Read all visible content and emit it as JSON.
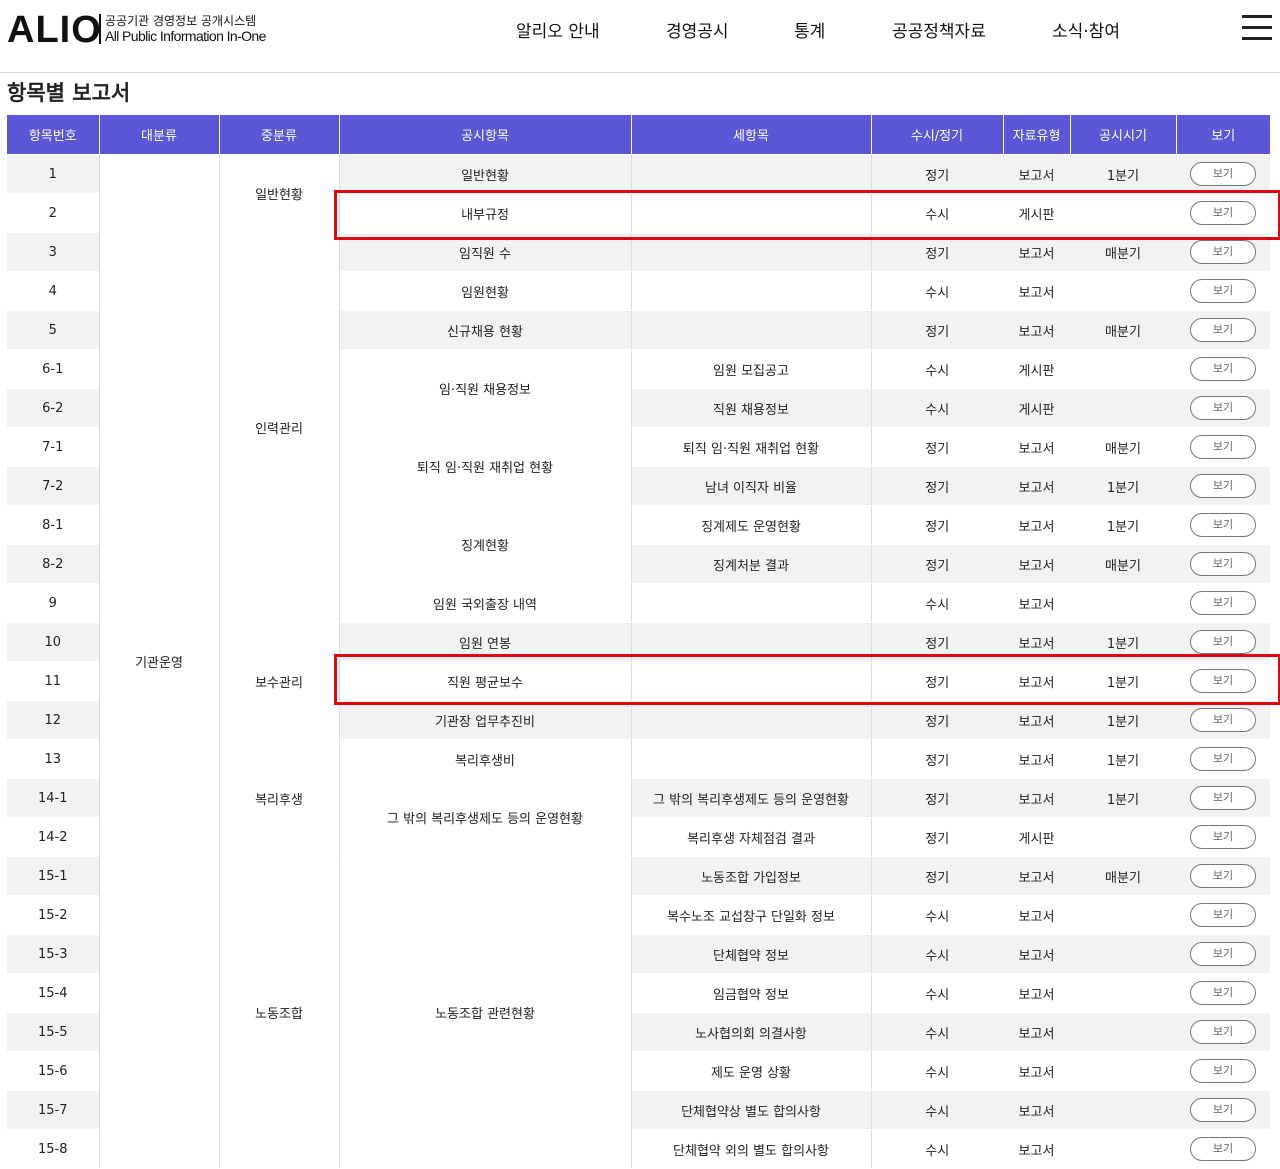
{
  "header": {
    "logo": "ALIO",
    "logo_ko": "공공기관 경영정보 공개시스템",
    "logo_en": "All Public Information In-One",
    "nav": [
      "알리오 안내",
      "경영공시",
      "통계",
      "공공정책자료",
      "소식·참여"
    ]
  },
  "page_title": "항목별 보고서",
  "table": {
    "columns": [
      "항목번호",
      "대분류",
      "중분류",
      "공시항목",
      "세항목",
      "수시/정기",
      "자료유형",
      "공시시기",
      "보기"
    ],
    "button_label": "보기",
    "rows": [
      {
        "no": "1",
        "item": "일반현황",
        "sub": "",
        "freq": "정기",
        "type": "보고서",
        "period": "1분기"
      },
      {
        "no": "2",
        "item": "내부규정",
        "sub": "",
        "freq": "수시",
        "type": "게시판",
        "period": ""
      },
      {
        "no": "3",
        "item": "임직원 수",
        "sub": "",
        "freq": "정기",
        "type": "보고서",
        "period": "매분기"
      },
      {
        "no": "4",
        "item": "임원현황",
        "sub": "",
        "freq": "수시",
        "type": "보고서",
        "period": ""
      },
      {
        "no": "5",
        "item": "신규채용 현황",
        "sub": "",
        "freq": "정기",
        "type": "보고서",
        "period": "매분기"
      },
      {
        "no": "6-1",
        "item": "임·직원 채용정보",
        "sub": "임원 모집공고",
        "freq": "수시",
        "type": "게시판",
        "period": ""
      },
      {
        "no": "6-2",
        "item": "",
        "sub": "직원 채용정보",
        "freq": "수시",
        "type": "게시판",
        "period": ""
      },
      {
        "no": "7-1",
        "item": "퇴직 임·직원 재취업 현황",
        "sub": "퇴직 임·직원 재취업 현황",
        "freq": "정기",
        "type": "보고서",
        "period": "매분기"
      },
      {
        "no": "7-2",
        "item": "",
        "sub": "남녀 이직자 비율",
        "freq": "정기",
        "type": "보고서",
        "period": "1분기"
      },
      {
        "no": "8-1",
        "item": "징계현황",
        "sub": "징계제도 운영현황",
        "freq": "정기",
        "type": "보고서",
        "period": "1분기"
      },
      {
        "no": "8-2",
        "item": "",
        "sub": "징계처분 결과",
        "freq": "정기",
        "type": "보고서",
        "period": "매분기"
      },
      {
        "no": "9",
        "item": "임원 국외출장 내역",
        "sub": "",
        "freq": "수시",
        "type": "보고서",
        "period": ""
      },
      {
        "no": "10",
        "item": "임원 연봉",
        "sub": "",
        "freq": "정기",
        "type": "보고서",
        "period": "1분기"
      },
      {
        "no": "11",
        "item": "직원 평균보수",
        "sub": "",
        "freq": "정기",
        "type": "보고서",
        "period": "1분기"
      },
      {
        "no": "12",
        "item": "기관장 업무추진비",
        "sub": "",
        "freq": "정기",
        "type": "보고서",
        "period": "1분기"
      },
      {
        "no": "13",
        "item": "복리후생비",
        "sub": "",
        "freq": "정기",
        "type": "보고서",
        "period": "1분기"
      },
      {
        "no": "14-1",
        "item": "그 밖의 복리후생제도 등의 운영현황",
        "sub": "그 밖의 복리후생제도 등의 운영현황",
        "freq": "정기",
        "type": "보고서",
        "period": "1분기"
      },
      {
        "no": "14-2",
        "item": "",
        "sub": "복리후생 자체점검 결과",
        "freq": "정기",
        "type": "게시판",
        "period": ""
      },
      {
        "no": "15-1",
        "item": "노동조합 관련현황",
        "sub": "노동조합 가입정보",
        "freq": "정기",
        "type": "보고서",
        "period": "매분기"
      },
      {
        "no": "15-2",
        "item": "",
        "sub": "복수노조 교섭창구 단일화 정보",
        "freq": "수시",
        "type": "보고서",
        "period": ""
      },
      {
        "no": "15-3",
        "item": "",
        "sub": "단체협약 정보",
        "freq": "수시",
        "type": "보고서",
        "period": ""
      },
      {
        "no": "15-4",
        "item": "",
        "sub": "임금협약 정보",
        "freq": "수시",
        "type": "보고서",
        "period": ""
      },
      {
        "no": "15-5",
        "item": "",
        "sub": "노사협의회 의결사항",
        "freq": "수시",
        "type": "보고서",
        "period": ""
      },
      {
        "no": "15-6",
        "item": "",
        "sub": "제도 운영 상황",
        "freq": "수시",
        "type": "보고서",
        "period": ""
      },
      {
        "no": "15-7",
        "item": "",
        "sub": "단체협약상 별도 합의사항",
        "freq": "수시",
        "type": "보고서",
        "period": ""
      },
      {
        "no": "15-8",
        "item": "",
        "sub": "단체협약 외의 별도 합의사항",
        "freq": "수시",
        "type": "보고서",
        "period": ""
      }
    ],
    "major": "기관운영",
    "middle": [
      "일반현황",
      "인력관리",
      "보수관리",
      "복리후생",
      "노동조합"
    ]
  },
  "colors": {
    "header_bg": "#5a58d6",
    "stripe": "#f2f2f2",
    "highlight": "#e3000f"
  }
}
